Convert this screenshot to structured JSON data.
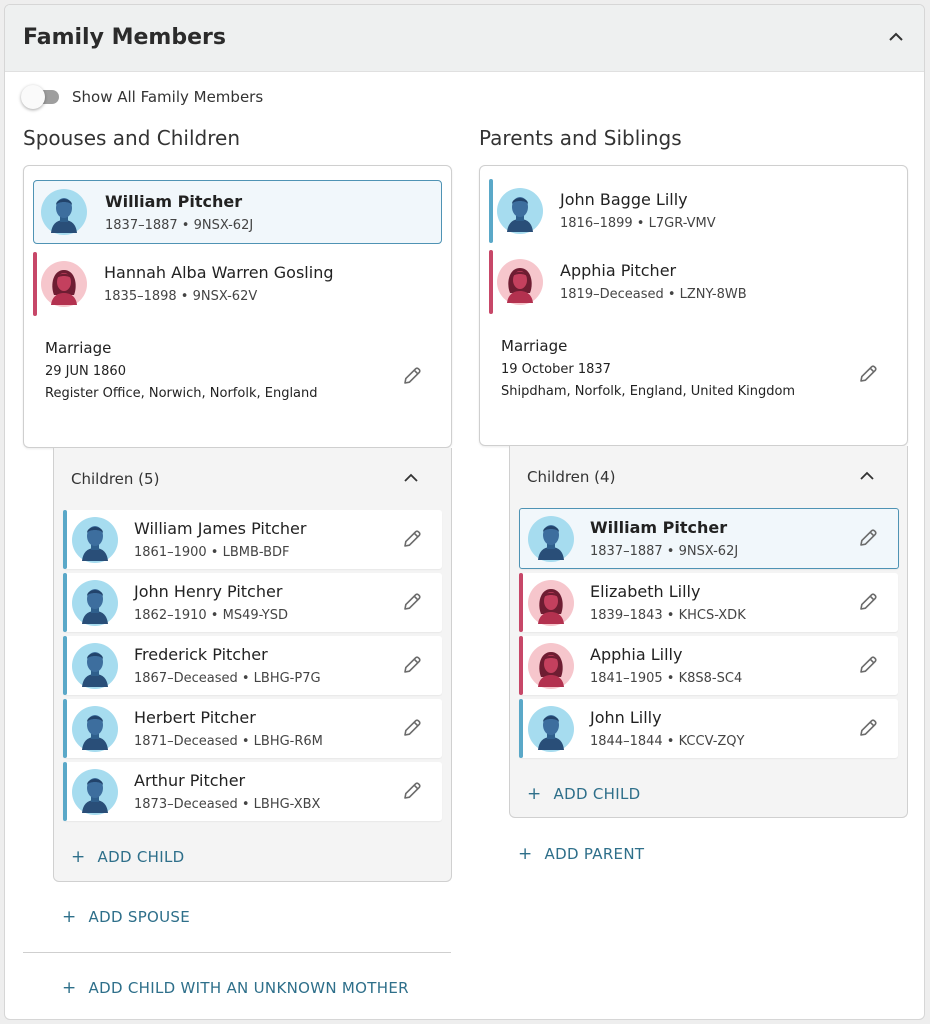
{
  "header": {
    "title": "Family Members"
  },
  "toggle": {
    "label": "Show All Family Members"
  },
  "left": {
    "title": "Spouses and Children",
    "couple": [
      {
        "name": "William Pitcher",
        "meta": "1837–1887 •  9NSX-62J",
        "gender": "male"
      },
      {
        "name": "Hannah Alba Warren Gosling",
        "meta": "1835–1898 •  9NSX-62V",
        "gender": "female"
      }
    ],
    "marriage": {
      "label": "Marriage",
      "date": "29 JUN 1860",
      "place": "Register Office, Norwich, Norfolk, England"
    },
    "children_title": "Children (5)",
    "children": [
      {
        "name": "William James Pitcher",
        "meta": "1861–1900 •  LBMB-BDF",
        "gender": "male"
      },
      {
        "name": "John Henry Pitcher",
        "meta": "1862–1910 •  MS49-YSD",
        "gender": "male"
      },
      {
        "name": "Frederick Pitcher",
        "meta": "1867–Deceased •  LBHG-P7G",
        "gender": "male"
      },
      {
        "name": "Herbert Pitcher",
        "meta": "1871–Deceased •  LBHG-R6M",
        "gender": "male"
      },
      {
        "name": "Arthur Pitcher",
        "meta": "1873–Deceased •  LBHG-XBX",
        "gender": "male"
      }
    ],
    "add_child": "ADD CHILD",
    "add_spouse": "ADD SPOUSE",
    "add_child_unknown": "ADD CHILD WITH AN UNKNOWN MOTHER"
  },
  "right": {
    "title": "Parents and Siblings",
    "couple": [
      {
        "name": "John Bagge Lilly",
        "meta": "1816–1899 •  L7GR-VMV",
        "gender": "male"
      },
      {
        "name": "Apphia Pitcher",
        "meta": "1819–Deceased •  LZNY-8WB",
        "gender": "female"
      }
    ],
    "marriage": {
      "label": "Marriage",
      "date": "19 October 1837",
      "place": "Shipdham, Norfolk, England, United Kingdom"
    },
    "children_title": "Children (4)",
    "children": [
      {
        "name": "William Pitcher",
        "meta": "1837–1887 •  9NSX-62J",
        "gender": "male"
      },
      {
        "name": "Elizabeth Lilly",
        "meta": "1839–1843 •  KHCS-XDK",
        "gender": "female"
      },
      {
        "name": "Apphia Lilly",
        "meta": "1841–1905 •  K8S8-SC4",
        "gender": "female"
      },
      {
        "name": "John Lilly",
        "meta": "1844–1844 •  KCCV-ZQY",
        "gender": "male"
      }
    ],
    "add_child": "ADD CHILD",
    "add_parent": "ADD PARENT"
  },
  "icons": {
    "add": "plus-icon",
    "edit": "pencil-icon",
    "collapse": "chevron-up-icon"
  },
  "colors": {
    "male": "#5aa8c8",
    "female": "#c74768",
    "link": "#2e6f8a",
    "selected_border": "#4f93b4"
  }
}
